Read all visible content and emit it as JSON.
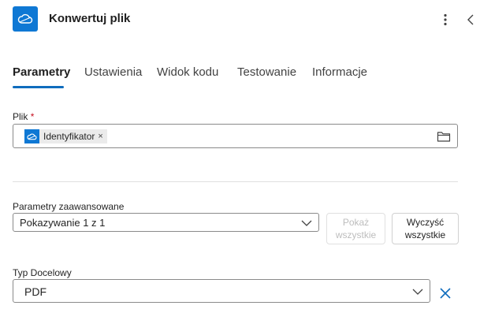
{
  "header": {
    "title": "Konwertuj plik",
    "app_icon": "onedrive-cloud-icon",
    "more_icon": "more-vertical-icon",
    "collapse_icon": "chevron-left-icon"
  },
  "tabs": [
    {
      "label": "Parametry",
      "active": true
    },
    {
      "label": "Ustawienia",
      "active": false
    },
    {
      "label": "Widok kodu",
      "active": false
    },
    {
      "label": "Testowanie",
      "active": false
    },
    {
      "label": "Informacje",
      "active": false
    }
  ],
  "file_field": {
    "label": "Plik",
    "required_marker": "*",
    "token_label": "Identyfikator",
    "token_remove": "×",
    "browse_icon": "folder-icon"
  },
  "advanced": {
    "label": "Parametry zaawansowane",
    "selected": "Pokazywanie 1 z 1",
    "show_all_label": "Pokaż\nwszystkie",
    "clear_all_label": "Wyczyść\nwszystkie"
  },
  "target_type": {
    "label": "Typ Docelowy",
    "selected": "PDF",
    "clear_icon": "close-icon"
  },
  "colors": {
    "accent": "#0f6cbd",
    "icon_bg": "#0f78d4",
    "required": "#c50f1f"
  }
}
